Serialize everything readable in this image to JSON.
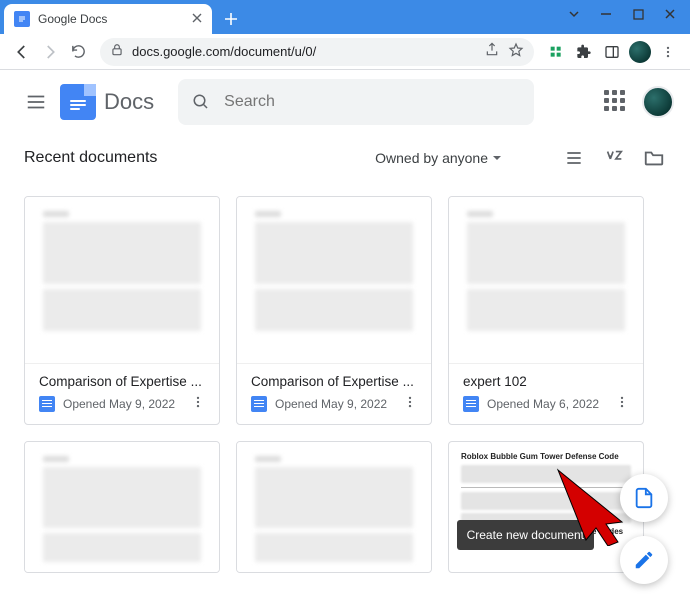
{
  "browser": {
    "tab_title": "Google Docs",
    "url": "docs.google.com/document/u/0/"
  },
  "app": {
    "name": "Docs",
    "search_placeholder": "Search"
  },
  "section": {
    "title": "Recent documents",
    "owned_by_label": "Owned by anyone"
  },
  "docs": [
    {
      "title": "Comparison of Expertise ...",
      "opened": "Opened May 9, 2022"
    },
    {
      "title": "Comparison of Expertise ...",
      "opened": "Opened May 9, 2022"
    },
    {
      "title": "expert 102",
      "opened": "Opened May 6, 2022"
    }
  ],
  "roblox_card": {
    "line1": "Roblox Bubble Gum Tower Defense Code",
    "line2": "Roblox Bubble Gum Tower Defense Codes"
  },
  "fab": {
    "tooltip": "Create new document"
  }
}
